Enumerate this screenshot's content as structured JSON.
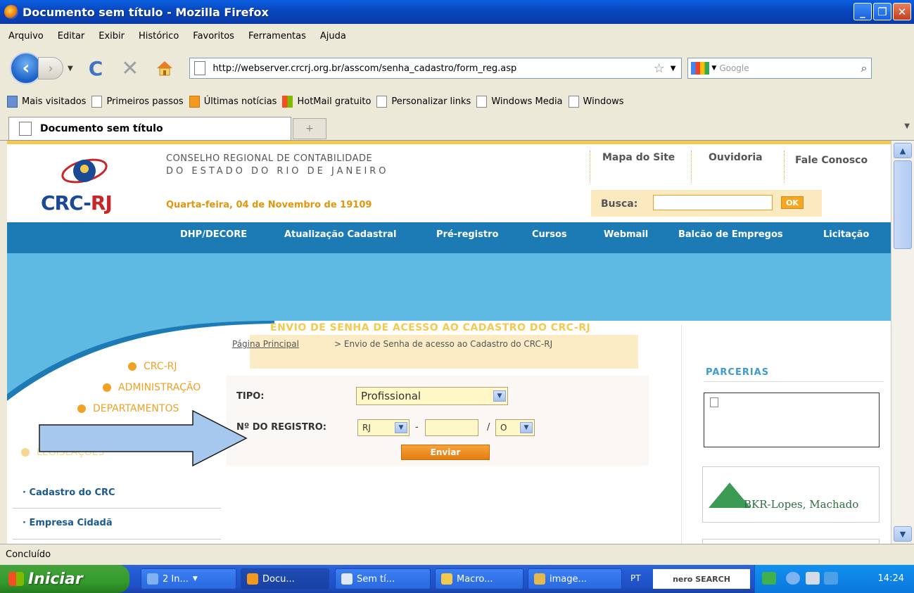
{
  "window": {
    "title": "Documento sem título - Mozilla Firefox"
  },
  "menu": [
    "Arquivo",
    "Editar",
    "Exibir",
    "Histórico",
    "Favoritos",
    "Ferramentas",
    "Ajuda"
  ],
  "navbar": {
    "url": "http://webserver.crcrj.org.br/asscom/senha_cadastro/form_reg.asp",
    "search_placeholder": "Google"
  },
  "bookmarks": [
    "Mais visitados",
    "Primeiros passos",
    "Últimas notícias",
    "HotMail gratuito",
    "Personalizar links",
    "Windows Media",
    "Windows"
  ],
  "tab": {
    "title": "Documento sem título",
    "new_tab": "+"
  },
  "site": {
    "logo": {
      "crc": "CRC-",
      "rj": "RJ"
    },
    "org_line1": "CONSELHO REGIONAL DE CONTABILIDADE",
    "org_line2": "DO ESTADO DO RIO DE JANEIRO",
    "date": "Quarta-feira, 04 de Novembro de 19109",
    "top_links": [
      "Mapa do Site",
      "Ouvidoria",
      "Fale Conosco"
    ],
    "search_label": "Busca:",
    "search_ok": "OK",
    "nav": [
      "DHP/DECORE",
      "Atualização Cadastral",
      "Pré-registro",
      "Cursos",
      "Webmail",
      "Balcão de Empregos",
      "Licitação"
    ],
    "page_title": "ENVIO DE SENHA DE ACESSO AO CADASTRO DO CRC-RJ",
    "breadcrumb_link": "Página Principal",
    "breadcrumb_rest": " > Envio de Senha de acesso ao Cadastro do CRC-RJ",
    "side_menu": [
      "CRC-RJ",
      "ADMINISTRAÇÃO",
      "DEPARTAMENTOS",
      "LEGISLAÇÕES"
    ],
    "left_links": [
      "Cadastro do CRC",
      "Empresa Cidadã"
    ],
    "form": {
      "tipo_label": "TIPO:",
      "tipo_value": "Profissional",
      "registro_label": "Nº DO REGISTRO:",
      "uf_value": "RJ",
      "dash": "-",
      "slash": "/",
      "cat_value": "O",
      "submit": "Enviar"
    },
    "parcerias_title": "PARCERIAS",
    "partner_name": "BKR-Lopes, Machado"
  },
  "status": "Concluído",
  "taskbar": {
    "start": "Iniciar",
    "tasks": [
      "2 In...",
      "Docu...",
      "Sem tí...",
      "Macro...",
      "image..."
    ],
    "lang": "PT",
    "nero": "nero SEARCH",
    "clock": "14:24"
  },
  "colors": {
    "nav_blue": "#1c7ab4",
    "banner_blue": "#5ebae3",
    "accent_orange": "#f0a126",
    "arrow": "#a6c8ef"
  }
}
